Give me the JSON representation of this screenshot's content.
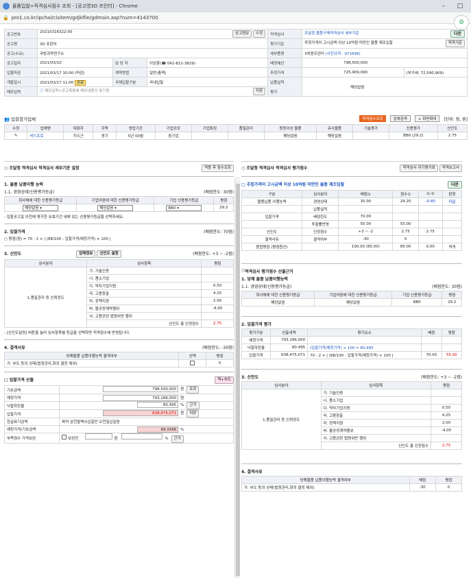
{
  "window": {
    "title": "물품입찰>적격심사점수 조회 - [공고명3D 프린터] - Chrome",
    "url": "pro1.co.kr/ipchal/cisitem/gdjkfile/gdmain.asp?num=4143700"
  },
  "info": {
    "gongo_no_label": "공고번호",
    "gongo_no": "20210316322-00",
    "btn_gongo": "공고원문",
    "btn_save": "수정",
    "gongo_name_label": "공고명",
    "gongo_name": "3D 프린터",
    "demand_label": "공고(수요)",
    "demand": "국방과학연구소",
    "date_label": "공고일자",
    "date": "2021/03/10",
    "manager_label": "담 당 자",
    "manager": "이상훈(☎ 042-821-3829)",
    "close_label": "입찰마감",
    "close": "2021/03/17 10:00 (마감)",
    "contract_label": "계약방법",
    "contract": "일반(총액)",
    "open_label": "개찰일시",
    "open": "2021/03/17 11:00",
    "open_badge": "완료",
    "intl_label": "국제입찰구분",
    "intl": "국내입찰",
    "memo_label": "메모입력",
    "memo": "메모입력>공고목록에 메모내용이 표기됨",
    "memo_btn": "저장",
    "judge_label": "적격심사",
    "judge": "조달청 물품구매적격심사 세부기준",
    "btn_plus": "다운",
    "eval_label": "평가기준",
    "eval": "추정가격이 고시금액 이상 10억원 미만인 물품 제조입찰",
    "btn_eval": "적격기준",
    "item_label": "세부품명",
    "item": "3차원프린터",
    "item_link": "(사전규격 : 971648)",
    "budget_label": "배정예산",
    "budget": "798,500,000",
    "est_label": "추정가격",
    "est": "725,909,090",
    "vat": "(부가세: 72,590,909)",
    "perf_label": "납품실적",
    "perf": "해당없음",
    "pg_label": "평가",
    "pg": ""
  },
  "company": {
    "title": "입찰참가업체",
    "btn_calc": "적격점수조회",
    "btn_search": "업체검색",
    "btn_expand": "+ 화면확대",
    "unit": "[단위: 점, 원]",
    "headers": [
      "수정",
      "업체명",
      "대표자",
      "지역",
      "영업기간",
      "기업규모",
      "기업특징",
      "품질관리",
      "동등이상 물품",
      "유사물품",
      "기술평가",
      "신용평가",
      "신인도"
    ],
    "row": {
      "name": "비드프로",
      "badge": "MFA",
      "ceo": "지도근",
      "region": "경기",
      "period": "5년 00월",
      "size": "중기업",
      "feat": "",
      "qual": "",
      "equal": "해당없음",
      "similar": "해당없음",
      "tech": "",
      "credit": "BB0 (29.2)",
      "trust": "2.75"
    }
  },
  "left": {
    "title": "조달청 적격심사 적격심사 세부기준 설정",
    "btn_apply": "적용 후 점수조회",
    "s1": "1. 물품 납품이행 능력",
    "s11": "1.1. 경영상태(신용평가등급)",
    "s11_limit": "(배점한도: 30점)",
    "s11_headers": [
      "회사채에 대한 신용평가등급",
      "기업어음에 대한 신용평가등급",
      "기업 신용평가등급",
      "평점"
    ],
    "s11_vals": [
      "해당없음",
      "해당없음",
      "BB0",
      "29.2"
    ],
    "s11_note": "- 입찰공고일 이전에 평가한 유효기간 내에 있는 신용평가등급을 선택하세요.",
    "s2": "2. 입찰가격",
    "s2_limit": "(배점한도: 70점)",
    "s2_formula": "○ 평점(점) = 70 - 2 × | (88/100 - 입찰가격/예정가격) × 100 |",
    "s3": "3. 신인도",
    "s3_btn1": "업체정보",
    "s3_btn2": "신인도 설정",
    "s3_limit": "(배점한도: +3 ~ -2점)",
    "s3_headers": [
      "심사분야",
      "심사항목",
      "평점"
    ],
    "s3_field": "1.품질관리 등 신뢰정도",
    "s3_rows": [
      [
        "가. 기술인증",
        ""
      ],
      [
        "나. 품소기업",
        ""
      ],
      [
        "다. 약자기업지원",
        "0.50"
      ],
      [
        "라. 고용창출",
        "4.25"
      ],
      [
        "마. 정책지원",
        "2.00"
      ],
      [
        "바. 불공정계약행위",
        "-4.00"
      ],
      [
        "사. 고용관련 법령위반 행위",
        ""
      ]
    ],
    "s3_total_label": "신인도 총 인정점수",
    "s3_total": "2.75",
    "s3_note": "- [신인도설정] 버튼을 눌러 심사항목별 등급을 선택하면 적격점수에 반영됩니다.",
    "s4": "4. 결격사유",
    "s4_limit": "(배점한도: -30점)",
    "s4_headers": [
      "당해물품 납품이행능력 결격여부",
      "선택",
      "평점"
    ],
    "s4_row": [
      "가. 부도 등의 상태(법정관리,화의 결정 제외)",
      "",
      "0"
    ],
    "s5": "입찰가격 산출",
    "s5_btn": "책+차트",
    "s5_rows": [
      {
        "label": "기초금액",
        "value": "798,500,000",
        "unit": "원",
        "btn": "조회"
      },
      {
        "label": "예정가격",
        "value": "793,186,000",
        "unit": "원",
        "btn": ""
      },
      {
        "label": "낙찰하한율",
        "value": "80.495",
        "unit": "%",
        "btn": "근거"
      },
      {
        "label": "입찰가격",
        "value": "638,475,071",
        "unit": "원",
        "btn": "저장"
      },
      {
        "label": "한글표기금액",
        "value": "육억 삼천팔백사십칠만 오천칠십일원",
        "unit": "",
        "btn": ""
      },
      {
        "label": "예정가격/기초금액",
        "value": "99.3346",
        "unit": "%",
        "btn": ""
      },
      {
        "label": "부족점수 가격보완",
        "value": "",
        "unit": "%",
        "btn": "근거"
      }
    ],
    "s5_check": "보완전",
    "s5_pt": "점"
  },
  "right": {
    "title": "조달청 적격심사 적격심사 평가점수",
    "btn1": "적격심사 자기평가표",
    "btn2": "적격보고서",
    "box_title": "추정가격이 고시금액 이상 10억원 미만인 물품 제조입찰",
    "btn_down": "다운",
    "score_headers": [
      "구분",
      "심사분야",
      "배점①",
      "점수②",
      "①-②",
      "판정"
    ],
    "score_rows": [
      [
        "물품납품 이행능력",
        "경영상태",
        "30.00",
        "29.20",
        "-0.80",
        "미달"
      ],
      [
        "",
        "납품실적",
        "",
        "",
        "",
        ""
      ],
      [
        "입찰가격",
        "배점한도",
        "70.00",
        "",
        "",
        ""
      ],
      [
        "",
        "투찰률반영",
        "55.00",
        "55.00",
        "",
        ""
      ],
      [
        "신인도",
        "인정점수",
        "+3 ~ -2",
        "2.75",
        "2.75",
        ""
      ],
      [
        "결격사유",
        "결격여부",
        "-30",
        "0",
        "",
        ""
      ],
      [
        "종합평점 (평점합산)",
        "",
        "100.00 (85.00)",
        "85.00",
        "0.00",
        "적격"
      ]
    ],
    "basis_title": "적격심사 평가점수 산출근거",
    "b1": "1. 당해 물품 납품이행능력",
    "b11": "1.1. 경영상태(신용평가등급)",
    "b11_limit": "(배점한도: 30점)",
    "b11_headers": [
      "회사채에 대한 신용평가등급",
      "기업어음에 대한 신용평가등급",
      "기업 신용평가등급",
      "평점"
    ],
    "b11_vals": [
      "해당없음",
      "해당없음",
      "BB0",
      "29.2"
    ],
    "b2": "2. 입찰가격 평가",
    "b2_headers": [
      "평가구분",
      "산출내역",
      "평가요소",
      "배점",
      "평점"
    ],
    "b2_rows": [
      [
        "예정가격",
        "793,186,000",
        "",
        "",
        ""
      ],
      [
        "낙찰하한율",
        "80.495",
        "(입찰가격/예정가격) × 100 = 80.495",
        "",
        ""
      ],
      [
        "입찰가격",
        "638,475,071",
        "70 - 2 × | (88/100 - 입찰가격/예정가격) × 100 |",
        "70.00",
        "55.00"
      ]
    ],
    "b3": "3. 신인도",
    "b3_limit": "(배점한도: +3 ~ -2점)",
    "b3_headers": [
      "심사분야",
      "심사항목",
      "평점"
    ],
    "b3_field": "1.품질관리 등 신뢰정도",
    "b3_rows": [
      [
        "가. 기술인증",
        ""
      ],
      [
        "나. 품소기업",
        ""
      ],
      [
        "다. 약자기업지원",
        "0.50"
      ],
      [
        "라. 고용창출",
        "4.25"
      ],
      [
        "마. 정책지원",
        "2.00"
      ],
      [
        "바. 불공정계약행위",
        "-4.00"
      ],
      [
        "사. 고용관련 법령위반 행위",
        ""
      ]
    ],
    "b3_total_label": "신인도 총 인정점수",
    "b3_total": "2.75",
    "b4": "4. 결격사유",
    "b4_headers": [
      "당해물품 납품이행능력 결격여부",
      "배점",
      "평점"
    ],
    "b4_row": [
      "가. 부도 등의 상태(법정관리,화의 결정 제외)",
      "-30",
      "0"
    ]
  }
}
